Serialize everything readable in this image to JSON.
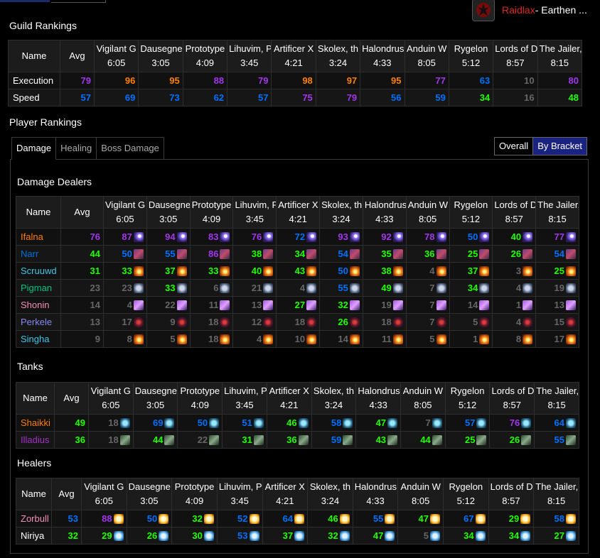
{
  "header": {
    "guild_name": "Raidlax",
    "realm_text": " - Earthen ..."
  },
  "colors": {
    "legendary": "#e268a8",
    "astounding": "#ff8000",
    "epic": "#a335ee",
    "rare": "#0070ff",
    "uncommon": "#1eff00",
    "common": "#666666",
    "selected_toggle": "#1a2380",
    "class_mage": "#3fc7eb",
    "class_shaman": "#0070dd",
    "class_monk": "#00ff98",
    "class_paladin": "#f48cba",
    "class_warlock": "#8788ee",
    "class_death_knight": "#c41e3a",
    "class_druid": "#ff7c0a",
    "class_demon_hunter": "#a330c9",
    "class_priest": "#ffffff"
  },
  "bosses": [
    {
      "name": "Vigilant G",
      "time": "6:05"
    },
    {
      "name": "Dausegne",
      "time": "3:05"
    },
    {
      "name": "Prototype",
      "time": "4:09"
    },
    {
      "name": "Lihuvim, P",
      "time": "3:45"
    },
    {
      "name": "Artificer X",
      "time": "4:21"
    },
    {
      "name": "Skolex, th",
      "time": "3:24"
    },
    {
      "name": "Halondrus",
      "time": "4:33"
    },
    {
      "name": "Anduin W",
      "time": "8:05"
    },
    {
      "name": "Rygelon",
      "time": "5:12"
    },
    {
      "name": "Lords of D",
      "time": "8:57"
    },
    {
      "name": "The Jailer,",
      "time": "8:15"
    }
  ],
  "guild_rankings": {
    "title": "Guild Rankings",
    "col_name": "Name",
    "col_avg": "Avg",
    "rows": [
      {
        "label": "Execution",
        "avg": 79,
        "values": [
          96,
          95,
          88,
          79,
          98,
          97,
          95,
          77,
          63,
          10,
          80
        ]
      },
      {
        "label": "Speed",
        "avg": 57,
        "values": [
          69,
          73,
          62,
          57,
          75,
          79,
          56,
          59,
          34,
          16,
          48
        ]
      }
    ]
  },
  "player_rankings": {
    "title": "Player Rankings",
    "tabs": [
      "Damage",
      "Healing",
      "Boss Damage"
    ],
    "active_tab": "Damage",
    "toggle": {
      "overall": "Overall",
      "by_bracket": "By Bracket",
      "selected": "By Bracket"
    },
    "damage": {
      "title": "Damage Dealers",
      "col_name": "Name",
      "col_avg": "Avg",
      "rows": [
        {
          "name": "Ifalna",
          "class_color": "#ff7c0a",
          "icon": "balance-icon",
          "avg": 76,
          "values": [
            87,
            94,
            83,
            76,
            72,
            93,
            92,
            78,
            50,
            40,
            77
          ]
        },
        {
          "name": "Narr",
          "class_color": "#0070dd",
          "icon": "elemental-icon",
          "avg": 44,
          "values": [
            50,
            55,
            86,
            38,
            34,
            54,
            35,
            36,
            25,
            26,
            54
          ]
        },
        {
          "name": "Scruuwd",
          "class_color": "#3fc7eb",
          "icon": "fire-icon",
          "avg": 31,
          "values": [
            33,
            37,
            33,
            40,
            43,
            50,
            38,
            4,
            37,
            3,
            25
          ]
        },
        {
          "name": "Pigman",
          "class_color": "#00c484",
          "icon": "windwalker-icon",
          "avg": 23,
          "values": [
            23,
            33,
            6,
            21,
            4,
            55,
            49,
            7,
            34,
            4,
            19
          ]
        },
        {
          "name": "Shonin",
          "class_color": "#f48cba",
          "icon": "retribution-icon",
          "avg": 14,
          "values": [
            4,
            22,
            11,
            13,
            27,
            32,
            19,
            7,
            14,
            1,
            13
          ]
        },
        {
          "name": "Perkele",
          "class_color": "#8788ee",
          "icon": "destruction-icon",
          "avg": 13,
          "values": [
            17,
            9,
            18,
            12,
            18,
            26,
            18,
            7,
            5,
            4,
            15
          ]
        },
        {
          "name": "Singha",
          "class_color": "#3fc7eb",
          "icon": "fire-icon",
          "avg": 9,
          "values": [
            8,
            5,
            18,
            4,
            10,
            14,
            11,
            5,
            1,
            8,
            17
          ]
        }
      ]
    },
    "tanks": {
      "title": "Tanks",
      "col_name": "Name",
      "col_avg": "Avg",
      "rows": [
        {
          "name": "Shaikki",
          "class_color": "#ff7c0a",
          "icon": "guardian-icon",
          "avg": 49,
          "values": [
            18,
            69,
            50,
            51,
            46,
            58,
            47,
            7,
            57,
            76,
            64
          ]
        },
        {
          "name": "Illadius",
          "class_color": "#a330c9",
          "icon": "vengeance-icon",
          "avg": 36,
          "values": [
            18,
            44,
            22,
            31,
            36,
            59,
            43,
            44,
            25,
            26,
            55
          ]
        }
      ]
    },
    "healers": {
      "title": "Healers",
      "col_name": "Name",
      "col_avg": "Avg",
      "rows": [
        {
          "name": "Zorbull",
          "class_color": "#f48cba",
          "icon": "holy-paladin-icon",
          "avg": 53,
          "values": [
            88,
            50,
            32,
            52,
            64,
            46,
            55,
            47,
            67,
            29,
            58
          ]
        },
        {
          "name": "Niriya",
          "class_color": "#ffffff",
          "icon": "discipline-icon",
          "avg": 32,
          "values": [
            29,
            26,
            30,
            53,
            37,
            32,
            47,
            5,
            34,
            34,
            27
          ]
        }
      ]
    }
  }
}
